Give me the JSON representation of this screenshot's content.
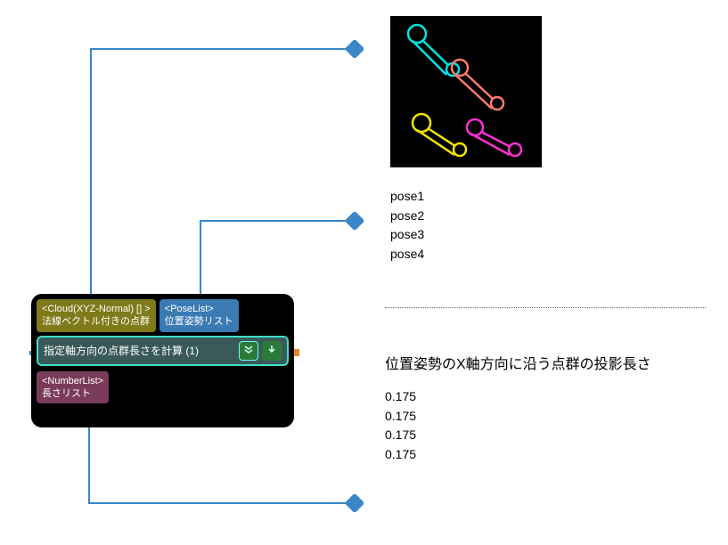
{
  "node": {
    "ports": {
      "cloud": {
        "type": "<Cloud(XYZ-Normal) [] >",
        "label": "法線ベクトル付きの点群"
      },
      "poselist": {
        "type": "<PoseList>",
        "label": "位置姿勢リスト"
      },
      "numberlist": {
        "type": "<NumberList>",
        "label": "長さリスト"
      }
    },
    "title": "指定軸方向の点群長さを計算 (1)",
    "button_a_icon": "chevrons-down",
    "button_b_icon": "download-arrow"
  },
  "thumbnail": {
    "desc": "4 connecting-rod silhouettes on black",
    "objects": [
      {
        "color": "#00e5e5"
      },
      {
        "color": "#ff7a6e"
      },
      {
        "color": "#f2e600"
      },
      {
        "color": "#ff2fd6"
      }
    ]
  },
  "poses": {
    "items": [
      "pose1",
      "pose2",
      "pose3",
      "pose4"
    ]
  },
  "heading": "位置姿勢のX軸方向に沿う点群の投影長さ",
  "lengths": {
    "items": [
      "0.175",
      "0.175",
      "0.175",
      "0.175"
    ]
  },
  "marker_color": "#3a86c8"
}
